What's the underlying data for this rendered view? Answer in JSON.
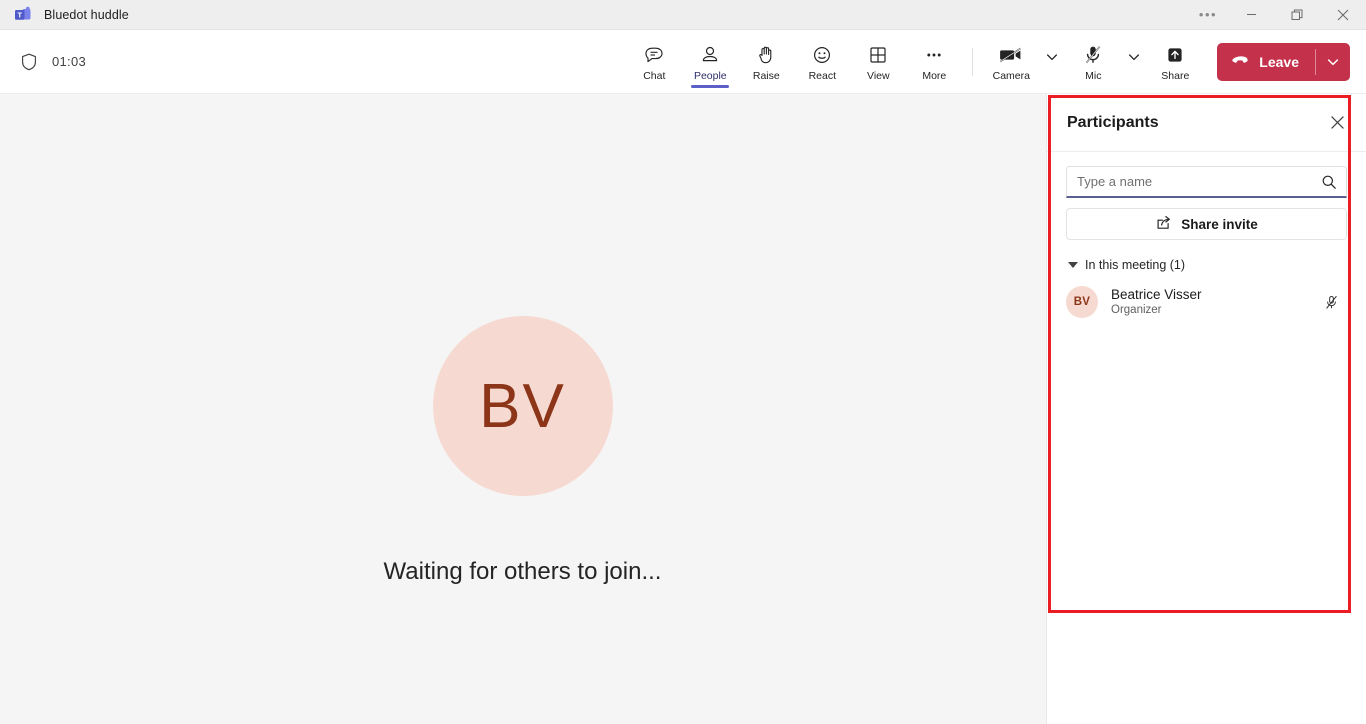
{
  "window": {
    "app_title": "Bluedot huddle",
    "logo_icon": "teams-logo-icon",
    "controls": [
      {
        "name": "more-window-options",
        "icon": "ellipsis-icon",
        "glyph": "•••"
      },
      {
        "name": "minimize",
        "icon": "minimize-icon",
        "glyph": "—"
      },
      {
        "name": "restore",
        "icon": "restore-icon",
        "glyph": "❐"
      },
      {
        "name": "close",
        "icon": "close-icon",
        "glyph": "✕"
      }
    ]
  },
  "toolbar": {
    "shield_icon": "shield-icon",
    "timer": "01:03",
    "items": [
      {
        "label": "Chat",
        "icon": "chat-icon",
        "active": false
      },
      {
        "label": "People",
        "icon": "people-icon",
        "active": true
      },
      {
        "label": "Raise",
        "icon": "raise-hand-icon",
        "active": false
      },
      {
        "label": "React",
        "icon": "react-smiley-icon",
        "active": false
      },
      {
        "label": "View",
        "icon": "view-grid-icon",
        "active": false
      },
      {
        "label": "More",
        "icon": "more-ellipsis-icon",
        "active": false
      }
    ],
    "devices": [
      {
        "label": "Camera",
        "icon": "camera-off-icon",
        "muted": true,
        "has_chevron": true
      },
      {
        "label": "Mic",
        "icon": "mic-off-icon",
        "muted": true,
        "has_chevron": true
      },
      {
        "label": "Share",
        "icon": "share-screen-icon",
        "muted": false,
        "has_chevron": false
      }
    ],
    "leave": {
      "label": "Leave",
      "icon": "hang-up-icon",
      "chevron_icon": "chevron-down-icon",
      "color": "#c4314b"
    }
  },
  "stage": {
    "avatar_initials": "BV",
    "avatar_bg": "#f6d9d0",
    "avatar_fg": "#8c3519",
    "message": "Waiting for others to join..."
  },
  "panel": {
    "title": "Participants",
    "close_icon": "close-icon",
    "search": {
      "placeholder": "Type a name",
      "value": "",
      "icon": "search-icon"
    },
    "share_invite": {
      "label": "Share invite",
      "icon": "share-invite-icon"
    },
    "section": {
      "label": "In this meeting (1)",
      "chevron_icon": "triangle-down-icon",
      "expanded": true
    },
    "participants": [
      {
        "initials": "BV",
        "name": "Beatrice Visser",
        "role": "Organizer",
        "mic_icon": "mic-off-icon",
        "muted": true
      }
    ]
  },
  "annotation": {
    "highlight_color": "#ec1c24"
  }
}
